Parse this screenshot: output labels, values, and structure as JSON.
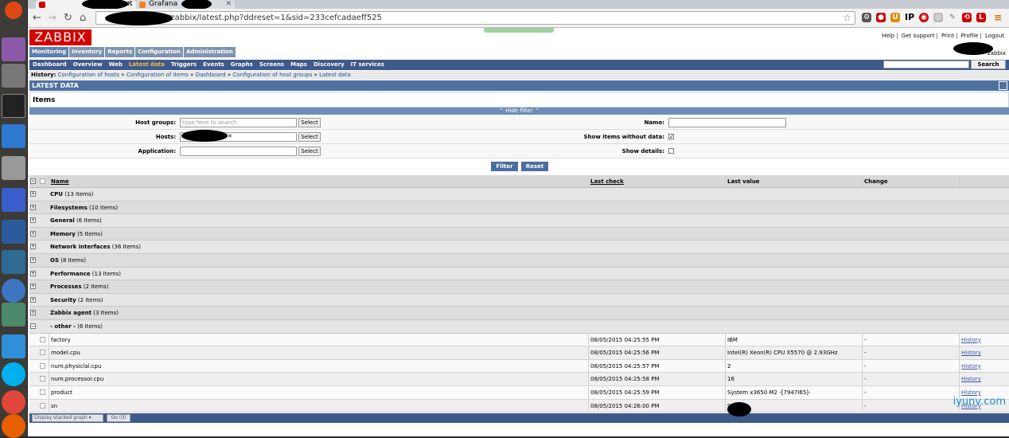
{
  "browser": {
    "tabs": [
      {
        "title": "zabbix: Lat",
        "active": true
      },
      {
        "title": "Grafana",
        "active": false
      }
    ],
    "url": "/zabbix/latest.php?ddreset=1&sid=233cefcadaeff525"
  },
  "header": {
    "logo": "ZABBIX",
    "top_links": [
      "Help",
      "Get support",
      "Print",
      "Profile",
      "Logout"
    ],
    "user": "zabbix"
  },
  "main_menu": [
    "Monitoring",
    "Inventory",
    "Reports",
    "Configuration",
    "Administration"
  ],
  "sub_menu": [
    "Dashboard",
    "Overview",
    "Web",
    "Latest data",
    "Triggers",
    "Events",
    "Graphs",
    "Screens",
    "Maps",
    "Discovery",
    "IT services"
  ],
  "sub_menu_selected": "Latest data",
  "search_button": "Search",
  "history": {
    "label": "History:",
    "items": [
      "Configuration of hosts",
      "Configuration of items",
      "Dashboard",
      "Configuration of host groups",
      "Latest data"
    ]
  },
  "page_title": "LATEST DATA",
  "items_title": "Items",
  "filter": {
    "toggle": "Hide filter",
    "host_groups_label": "Host groups:",
    "host_groups_placeholder": "type here to search",
    "hosts_label": "Hosts:",
    "application_label": "Application:",
    "select_label": "Select",
    "name_label": "Name:",
    "show_items_without_data_label": "Show items without data:",
    "show_items_without_data": true,
    "show_details_label": "Show details:",
    "show_details": false,
    "filter_button": "Filter",
    "reset_button": "Reset"
  },
  "table": {
    "columns": [
      "Name",
      "Last check",
      "Last value",
      "Change"
    ],
    "groups": [
      {
        "name": "CPU",
        "count": "(13 Items)"
      },
      {
        "name": "Filesystems",
        "count": "(10 Items)"
      },
      {
        "name": "General",
        "count": "(6 Items)"
      },
      {
        "name": "Memory",
        "count": "(5 Items)"
      },
      {
        "name": "Network interfaces",
        "count": "(36 Items)"
      },
      {
        "name": "OS",
        "count": "(8 Items)"
      },
      {
        "name": "Performance",
        "count": "(13 Items)"
      },
      {
        "name": "Processes",
        "count": "(2 Items)"
      },
      {
        "name": "Security",
        "count": "(2 Items)"
      },
      {
        "name": "Zabbix agent",
        "count": "(3 Items)"
      },
      {
        "name": "- other -",
        "count": "(6 Items)"
      }
    ],
    "items": [
      {
        "name": "factory",
        "last_check": "08/05/2015 04:25:55 PM",
        "last_value": "IBM",
        "change": "-",
        "link": "History"
      },
      {
        "name": "model.cpu",
        "last_check": "08/05/2015 04:25:56 PM",
        "last_value": "Intel(R) Xeon(R) CPU X5570 @ 2.93GHz",
        "change": "-",
        "link": "History"
      },
      {
        "name": "num.physiclal.cpu",
        "last_check": "08/05/2015 04:25:57 PM",
        "last_value": "2",
        "change": "-",
        "link": "History"
      },
      {
        "name": "num.processor.cpu",
        "last_check": "08/05/2015 04:25:58 PM",
        "last_value": "16",
        "change": "-",
        "link": "History"
      },
      {
        "name": "product",
        "last_check": "08/05/2015 04:25:59 PM",
        "last_value": "System x3650 M2 -[7947I65]-",
        "change": "-",
        "link": "History"
      },
      {
        "name": "sn",
        "last_check": "08/05/2015 04:26:00 PM",
        "last_value": "99",
        "change": "-",
        "link": "History"
      }
    ]
  },
  "footer": {
    "stacked_graph": "Display stacked graph",
    "go_button": "Go (0)"
  },
  "watermark": "iyunv.com"
}
